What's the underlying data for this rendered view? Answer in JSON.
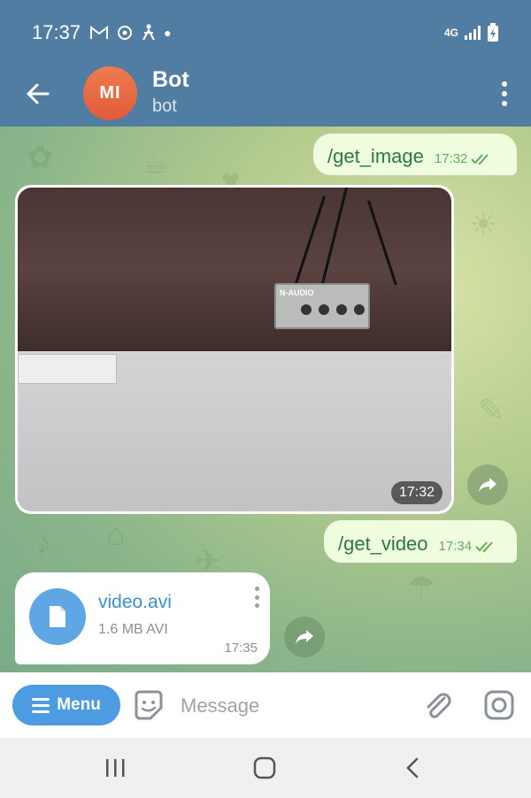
{
  "status_bar": {
    "time": "17:37",
    "network": "4G",
    "left_icons": [
      "gmail-icon",
      "sync-icon",
      "accessibility-icon",
      "dot-icon"
    ],
    "right_icons": [
      "network-4g-icon",
      "signal-icon",
      "battery-charging-icon"
    ]
  },
  "header": {
    "avatar_initials": "MI",
    "chat_name": "Bot",
    "chat_subtitle": "bot",
    "avatar_color": "#e3603e",
    "bar_color": "#527da3"
  },
  "messages": [
    {
      "type": "outgoing_text",
      "text": "/get_image",
      "time": "17:32",
      "status": "read"
    },
    {
      "type": "incoming_photo",
      "time": "17:32"
    },
    {
      "type": "outgoing_text",
      "text": "/get_video",
      "time": "17:34",
      "status": "read"
    },
    {
      "type": "incoming_file",
      "file_name": "video.avi",
      "file_info": "1.6 MB AVI",
      "time": "17:35"
    }
  ],
  "photo_labels": {
    "device_brand": "N-AUDIO"
  },
  "composer": {
    "menu_label": "Menu",
    "placeholder": "Message"
  },
  "colors": {
    "outgoing_bubble": "#effdde",
    "outgoing_text": "#2b7a3e",
    "accent": "#4d9be0",
    "file_icon": "#5ea7e4"
  }
}
